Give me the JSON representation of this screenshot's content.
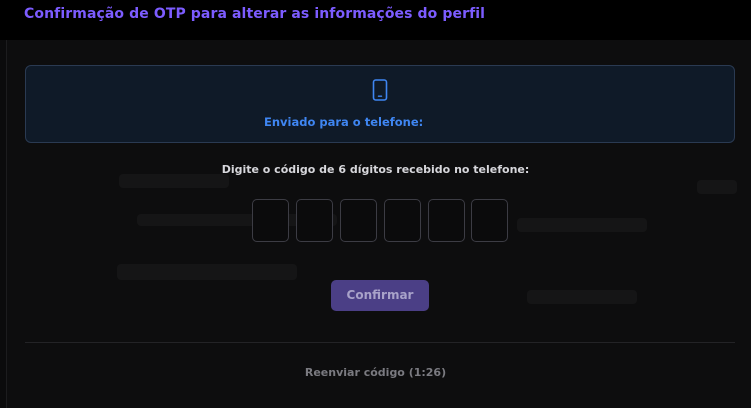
{
  "header": {
    "title": "Confirmação de OTP para alterar as informações do perfil"
  },
  "info": {
    "icon": "smartphone-icon",
    "sent_label": "Enviado para o telefone:"
  },
  "otp": {
    "instruction": "Digite o código de 6 dígitos recebido no telefone:",
    "digits": [
      "",
      "",
      "",
      "",
      "",
      ""
    ]
  },
  "actions": {
    "confirm_label": "Confirmar",
    "resend_label": "Reenviar código (1:26)"
  },
  "colors": {
    "accent": "#7c5cff",
    "info_blue": "#3f86f2",
    "button": "#4b3f86"
  }
}
